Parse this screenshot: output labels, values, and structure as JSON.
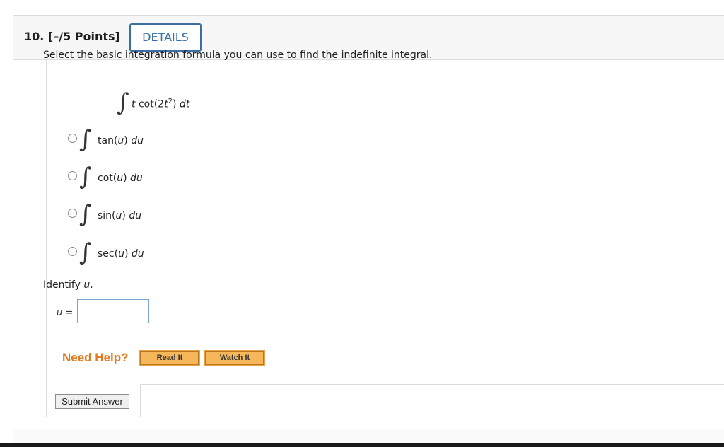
{
  "question": {
    "number_label": "10.",
    "points_label": "[–/5 Points]",
    "details_label": "DETAILS",
    "prompt": "Select the basic integration formula you can use to find the indefinite integral."
  },
  "integral": {
    "sign": "∫",
    "var_t": "t",
    "func": "cot(2",
    "var_t2": "t",
    "exponent": "2",
    "close": ")",
    "differential": "dt"
  },
  "options": [
    {
      "func": "tan(",
      "var": "u",
      "close": ")",
      "differential": "du"
    },
    {
      "func": "cot(",
      "var": "u",
      "close": ")",
      "differential": "du"
    },
    {
      "func": "sin(",
      "var": "u",
      "close": ")",
      "differential": "du"
    },
    {
      "func": "sec(",
      "var": "u",
      "close": ")",
      "differential": "du"
    }
  ],
  "identify": {
    "text": "Identify ",
    "var": "u",
    "period": "."
  },
  "answer": {
    "var": "u",
    "eq": " =",
    "value": ""
  },
  "help": {
    "need_help_label": "Need Help?",
    "read_it_label": "Read It",
    "watch_it_label": "Watch It"
  },
  "submit_label": "Submit Answer"
}
